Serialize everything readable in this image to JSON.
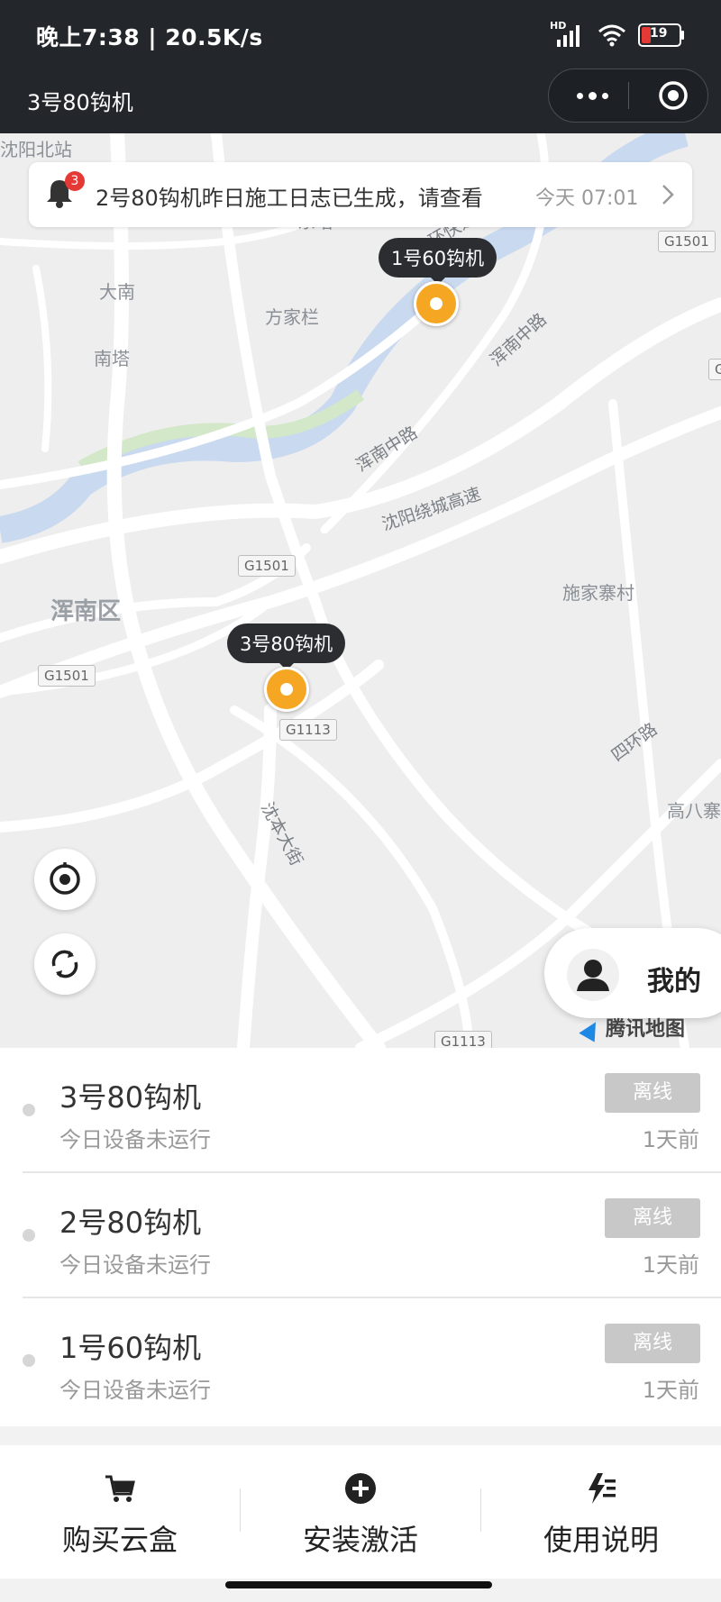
{
  "status_bar": {
    "time": "晚上7:38 | 20.5K/s",
    "network": "HD",
    "battery": "19"
  },
  "nav": {
    "title": "3号80钩机"
  },
  "notice": {
    "badge_count": "3",
    "message": "2号80钩机昨日施工日志已生成，请查看",
    "time": "今天 07:01"
  },
  "map": {
    "places": {
      "north_station": "沈阳北站",
      "dongta": "东塔",
      "danan": "大南",
      "fangjialan": "方家栏",
      "nanta": "南塔",
      "hunnan_district": "浑南区",
      "shijiazhai": "施家寨村",
      "gaobazhai": "高八寨"
    },
    "roads": {
      "ring_express": "二环快速路",
      "hunnan_mid_1": "浑南中路",
      "hunnan_mid_2": "浑南中路",
      "ring_highway": "沈阳绕城高速",
      "sihuan": "四环路",
      "shenben": "沈本大街"
    },
    "shields": {
      "g1501_a": "G1501",
      "g1501_b": "G1501",
      "g1501_c": "G1501",
      "g1113_a": "G1113",
      "g1113_b": "G1113",
      "g_right": "G"
    },
    "markers": {
      "m1": "1号60钩机",
      "m3": "3号80钩机"
    },
    "mine_label": "我的",
    "provider": "腾讯地图",
    "accent_color": "#f5a623"
  },
  "devices": [
    {
      "name": "3号80钩机",
      "status_text": "今日设备未运行",
      "tag": "离线",
      "ago": "1天前"
    },
    {
      "name": "2号80钩机",
      "status_text": "今日设备未运行",
      "tag": "离线",
      "ago": "1天前"
    },
    {
      "name": "1号60钩机",
      "status_text": "今日设备未运行",
      "tag": "离线",
      "ago": "1天前"
    }
  ],
  "tabbar": {
    "buy": {
      "label": "购买云盒",
      "icon": "cart-icon"
    },
    "install": {
      "label": "安装激活",
      "icon": "plus-circle-icon"
    },
    "guide": {
      "label": "使用说明",
      "icon": "flash-list-icon"
    }
  }
}
